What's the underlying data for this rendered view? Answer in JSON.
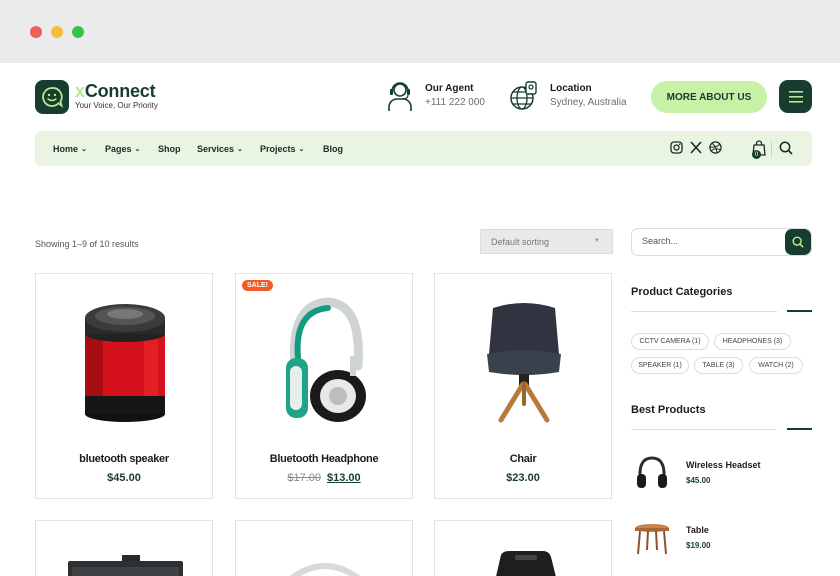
{
  "window": {
    "buttons": [
      "close",
      "minimize",
      "maximize"
    ]
  },
  "brand": {
    "name_prefix": "x",
    "name_rest": "Connect",
    "tagline": "Your Voice, Our Priority",
    "logo_icon": "smile-chat-icon"
  },
  "header": {
    "agent": {
      "title": "Our Agent",
      "value": "+111 222 000",
      "icon": "agent-headset-icon"
    },
    "location": {
      "title": "Location",
      "value": "Sydney, Australia",
      "icon": "globe-icon"
    },
    "cta_label": "MORE ABOUT US",
    "menu_icon": "hamburger-icon"
  },
  "nav": {
    "items": [
      {
        "label": "Home",
        "dropdown": true
      },
      {
        "label": "Pages",
        "dropdown": true
      },
      {
        "label": "Shop",
        "dropdown": false
      },
      {
        "label": "Services",
        "dropdown": true
      },
      {
        "label": "Projects",
        "dropdown": true
      },
      {
        "label": "Blog",
        "dropdown": false
      }
    ],
    "chevron": "⌄",
    "social_icons": [
      "instagram-icon",
      "x-icon",
      "dribbble-icon"
    ],
    "cart_count": "0"
  },
  "shop": {
    "result_count": "Showing 1–9 of 10 results",
    "sort_selected": "Default sorting",
    "products": [
      {
        "name": "bluetooth speaker",
        "price": "$45.00",
        "image": "speaker-image"
      },
      {
        "name": "Bluetooth Headphone",
        "old_price": "$17.00",
        "price": "$13.00",
        "badge": "SALE!",
        "image": "headphone-image"
      },
      {
        "name": "Chair",
        "price": "$23.00",
        "image": "chair-image"
      }
    ]
  },
  "sidebar": {
    "search_placeholder": "Search...",
    "categories_title": "Product Categories",
    "categories": [
      "CCTV CAMERA (1)",
      "HEADPHONES (3)",
      "SPEAKER (1)",
      "TABLE (3)",
      "WATCH (2)"
    ],
    "best_title": "Best Products",
    "best": [
      {
        "name": "Wireless Headset",
        "price": "$45.00",
        "image": "wireless-headset-image"
      },
      {
        "name": "Table",
        "price": "$19.00",
        "image": "table-image"
      }
    ]
  },
  "colors": {
    "brand_dark": "#173d31",
    "accent_green": "#c8f1a8",
    "nav_bg": "#e9f4e2",
    "sale": "#f15a24"
  }
}
